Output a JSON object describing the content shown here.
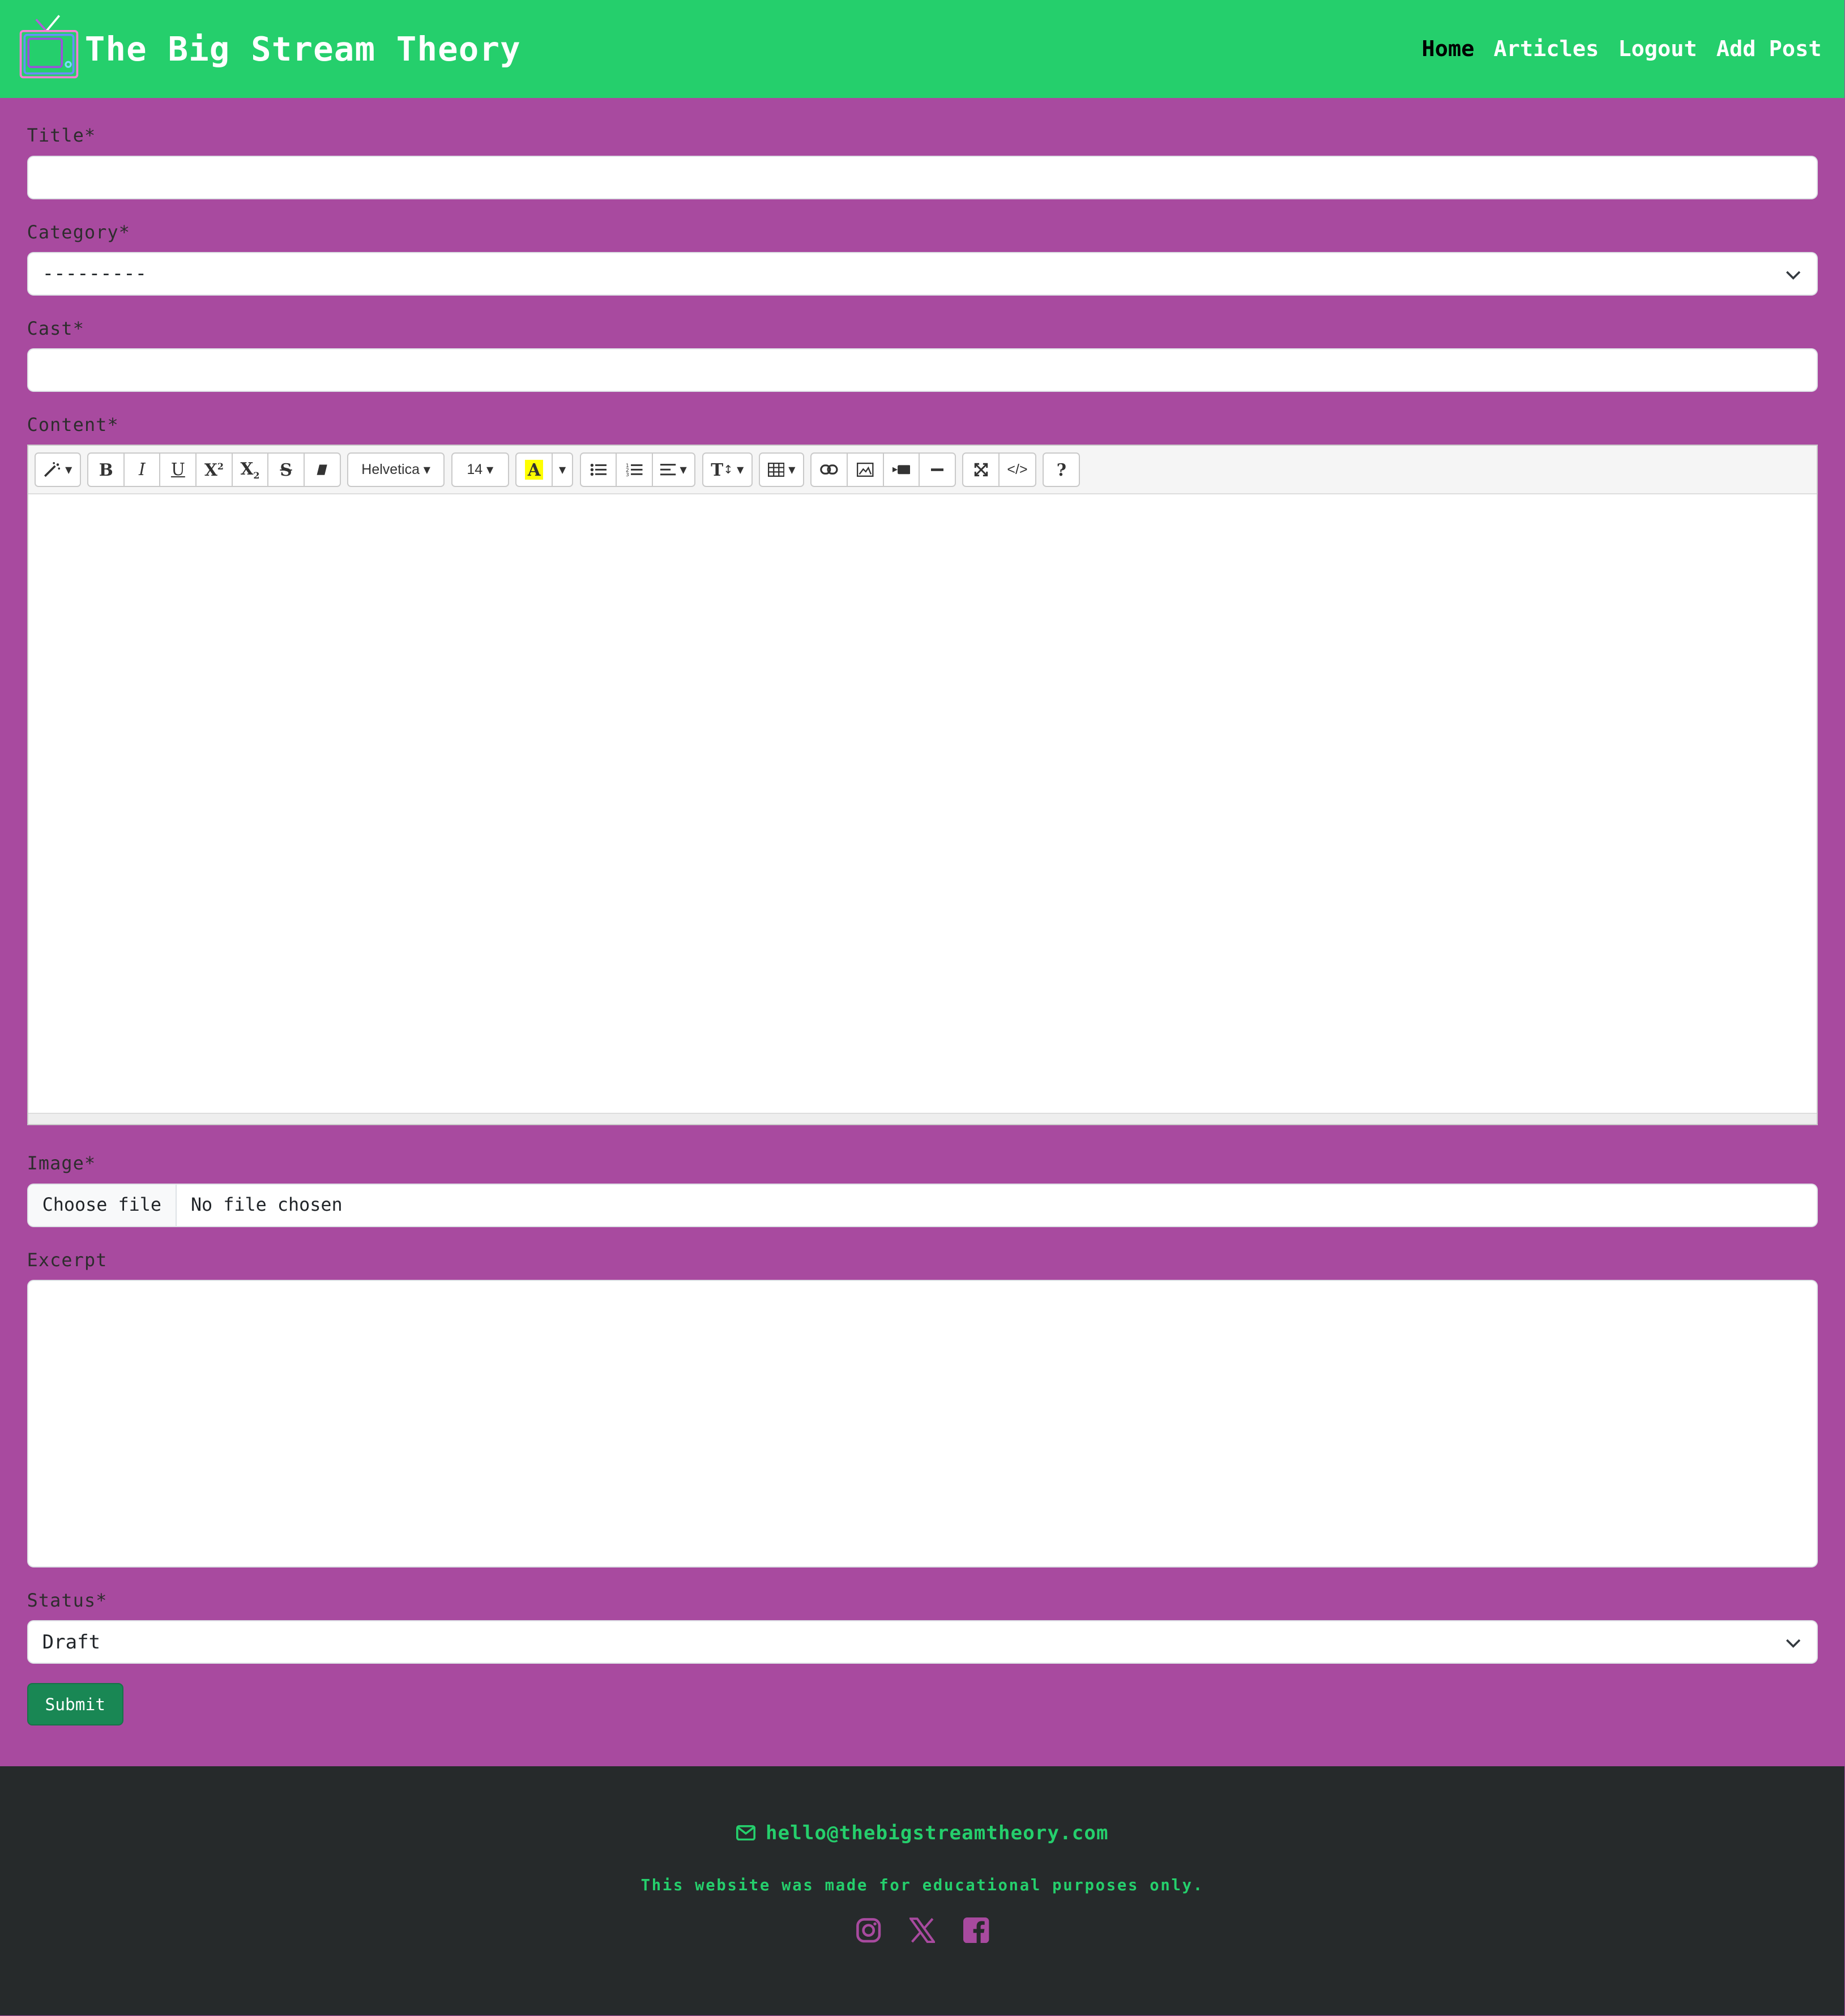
{
  "header": {
    "brand_title": "The Big Stream Theory",
    "nav": [
      {
        "label": "Home",
        "active": true
      },
      {
        "label": "Articles",
        "active": false
      },
      {
        "label": "Logout",
        "active": false
      },
      {
        "label": "Add Post",
        "active": false
      }
    ]
  },
  "form": {
    "title_label": "Title*",
    "title_value": "",
    "category_label": "Category*",
    "category_selected": "---------",
    "cast_label": "Cast*",
    "cast_value": "",
    "content_label": "Content*",
    "content_value": "",
    "image_label": "Image*",
    "image_button": "Choose file",
    "image_status": "No file chosen",
    "excerpt_label": "Excerpt",
    "excerpt_value": "",
    "status_label": "Status*",
    "status_selected": "Draft",
    "submit_label": "Submit"
  },
  "editor_toolbar": {
    "style_icon": "magic-icon",
    "font_name": "Helvetica",
    "font_size": "14",
    "color_letter": "A",
    "highlight_color": "#ffff00",
    "help_label": "?",
    "buttons": [
      "bold",
      "italic",
      "underline",
      "superscript",
      "subscript",
      "strikethrough",
      "clear-format",
      "unordered-list",
      "ordered-list",
      "paragraph-align",
      "line-height",
      "table",
      "link",
      "picture",
      "video",
      "horizontal-rule",
      "fullscreen",
      "code-view",
      "help"
    ]
  },
  "footer": {
    "email": "hello@thebigstreamtheory.com",
    "note": "This website was made for educational purposes only.",
    "social": [
      "instagram-icon",
      "x-twitter-icon",
      "facebook-icon"
    ]
  },
  "colors": {
    "header_bg": "#25cf6c",
    "page_bg": "#a84a9f",
    "footer_bg": "#262a2b",
    "submit_bg": "#198754",
    "accent_green": "#25cf6c"
  }
}
